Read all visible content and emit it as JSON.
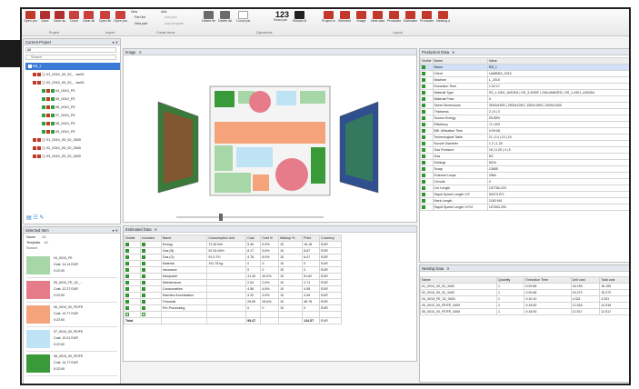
{
  "ribbon": {
    "buttons": [
      {
        "label": "Open project",
        "color": "#c0392b"
      },
      {
        "label": "Save",
        "color": "#b03030"
      },
      {
        "label": "Save as",
        "color": "#b03030"
      },
      {
        "label": "Close",
        "color": "#c94040"
      },
      {
        "label": "Clear all",
        "color": "#c94040"
      },
      {
        "label": "Open lib",
        "color": "#c94040"
      },
      {
        "label": "Open program",
        "color": "#c94040"
      }
    ],
    "new_header": "New",
    "new_items": [
      "Part list",
      "New part"
    ],
    "add_header": "Add",
    "add_items": [
      "Add part",
      "Add template"
    ],
    "ops_buttons": [
      {
        "label": "Delete item",
        "color": "#6b6b6b"
      },
      {
        "label": "Delete all items",
        "color": "#6b6b6b"
      },
      {
        "label": "Count parts",
        "color": "#9aa3ad"
      },
      {
        "label": "Read part values",
        "color": "#333333"
      },
      {
        "label": "Reload Materials",
        "color": "#222222"
      }
    ],
    "counter_glyph": "123",
    "layout_buttons": [
      {
        "label": "Project explorer",
        "color": "#c0392b"
      },
      {
        "label": "Selected parts",
        "color": "#c0392b"
      },
      {
        "label": "Image",
        "color": "#c0392b"
      },
      {
        "label": "Nest data",
        "color": "#c0392b"
      },
      {
        "label": "Production data",
        "color": "#c0392b"
      },
      {
        "label": "Estimated data",
        "color": "#c0392b"
      },
      {
        "label": "Production data",
        "color": "#c0392b"
      },
      {
        "label": "Nesting data",
        "color": "#c0392b"
      }
    ],
    "groups": [
      "Project",
      "Import",
      "Create items",
      "Operations",
      "Layout"
    ]
  },
  "project_panel": {
    "title": "Current Project",
    "filter": "All",
    "search_placeholder": "Search",
    "items": [
      {
        "label": "RB_1",
        "sel": true,
        "color": "#1f78c8"
      },
      {
        "label": "01_0010_00_02_...bw01",
        "color": "#c0392b"
      },
      {
        "label": "02_0010_00_02_...bw01",
        "color": "#c0392b"
      },
      {
        "label": "04_0010_FE",
        "color": "#3a9a3a"
      },
      {
        "label": "05_0010_FE",
        "color": "#3a9a3a"
      },
      {
        "label": "06_0010_FE",
        "color": "#3a9a3a"
      },
      {
        "label": "07_0010_FE",
        "color": "#3a9a3a"
      },
      {
        "label": "08_0010_FE",
        "color": "#3a9a3a"
      },
      {
        "label": "09_0010_FE",
        "color": "#3a9a3a"
      },
      {
        "label": "01_0010_00_02_3400",
        "color": "#c0392b"
      },
      {
        "label": "02_0010_00_02_3400",
        "color": "#c0392b"
      },
      {
        "label": "03_0010_00_02_3400",
        "color": "#c0392b"
      }
    ]
  },
  "image_panel": {
    "title": "Image"
  },
  "selected_panel": {
    "title": "Selected Item",
    "fields": [
      {
        "label": "Name",
        "value": "All"
      },
      {
        "label": "Template",
        "value": "All"
      }
    ],
    "search": "Search",
    "items": [
      {
        "name": "04_0010_FE",
        "value": "Cost: 14.14 EUR",
        "time": "0:22:00"
      },
      {
        "name": "05_0010_FE_02_...",
        "value": "Cost: 12.27 EUR",
        "time": "0:22:00"
      },
      {
        "name": "06_0010_00_FE/FE",
        "value": "Cost: 14.77 EUR",
        "time": "0:22:00"
      },
      {
        "name": "07_0010_00_FE/FE",
        "value": "Cost: 19.21 EUR",
        "time": "0:22:00"
      },
      {
        "name": "08_0010_00_FE/FE",
        "value": "Cost: 14.77 EUR",
        "time": "0:22:00"
      }
    ]
  },
  "estimated_panel": {
    "title": "Estimated Data",
    "columns": [
      "Visible",
      "Included",
      "Name",
      "Consumption Unit",
      "Cost",
      "Cost %",
      "Markup %",
      "Price",
      "Currency"
    ],
    "rows": [
      [
        "Energy",
        "72.45 Wh",
        "5.40",
        "6.9%",
        "10",
        "16.18",
        "EUR"
      ],
      [
        "Gas (N)",
        "92.34 kWh",
        "8.17",
        "5.6%",
        "10",
        "8.87",
        "EUR"
      ],
      [
        "Gas (O)",
        "91.0.79 l",
        "4.78",
        "8.0%",
        "10",
        "6.07",
        "EUR"
      ],
      [
        "Material",
        "191.78 kg",
        "0",
        "0",
        "10",
        "0",
        "EUR"
      ],
      [
        "Insurance",
        "",
        "0",
        "0",
        "10",
        "0",
        "EUR"
      ],
      [
        "Manpower",
        "",
        "41.40",
        "43.2%",
        "10",
        "51.62",
        "EUR"
      ],
      [
        "Maintenance",
        "",
        "2.54",
        "2.6%",
        "10",
        "2.71",
        "EUR"
      ],
      [
        "Consumables",
        "",
        "4.56",
        "4.8%",
        "10",
        "4.95",
        "EUR"
      ],
      [
        "Machine Amortization",
        "",
        "3.32",
        "3.5%",
        "10",
        "3.49",
        "EUR"
      ],
      [
        "Financial",
        "",
        "25.50",
        "26.6%",
        "10",
        "46.78",
        "EUR"
      ],
      [
        "Pre-Processing",
        "",
        "0",
        "0",
        "10",
        "0",
        "EUR"
      ]
    ],
    "total_label": "Total",
    "total_cost": "95.47",
    "total_price": "124.57",
    "total_currency": "EUR"
  },
  "production_panel": {
    "title": "Production Data",
    "columns": [
      "Visible",
      "Name",
      "Value"
    ],
    "rows": [
      [
        "Name",
        "RB_1"
      ],
      [
        "Client",
        "LAMBDA_2015"
      ],
      [
        "Machine",
        "L_2015"
      ],
      [
        "Execution Time",
        "1:22:17"
      ],
      [
        "Material Type",
        "SS_1.4301_AISI304 | SS_3.2030F | GALVANIZED | SS_1.4301_AISI304"
      ],
      [
        "Material Price",
        "0"
      ],
      [
        "Sheet Dimensions",
        "3000x1500 | 2500x1250 | 1500x1500 | 3000x1500"
      ],
      [
        "Thickness",
        "2 | 5 | 3"
      ],
      [
        "Source Energy",
        "25.55%"
      ],
      [
        "Efficiency",
        "71.15%"
      ],
      [
        "Biff. Utilisation Time",
        "0:09:08"
      ],
      [
        "Technological Table",
        "21 | 14 | 10 | 15"
      ],
      [
        "Nozzle Diameter",
        "1.2 | 1.25"
      ],
      [
        "Gas Pressure",
        "16 | 0.25 | 4 | 5"
      ],
      [
        "Gas",
        "N2"
      ],
      [
        "Drillings",
        "6024"
      ],
      [
        "Scrap",
        "13655"
      ],
      [
        "External Loops",
        "2564"
      ],
      [
        "Circuits",
        "0"
      ],
      [
        "Cut Length",
        "107760.223"
      ],
      [
        "Rapid Speed Length X/Y",
        "50073.971"
      ],
      [
        "Mark Length",
        "1180.941"
      ],
      [
        "Rapid Speed Length X/Y/Z",
        "107603.290"
      ]
    ]
  },
  "nesting_panel": {
    "title": "Nesting Data",
    "columns": [
      "Name",
      "Quantity",
      "Execution Time",
      "Unit cost",
      "Total cost"
    ],
    "rows": [
      [
        "01_0010_00_02_3400",
        "1",
        "0:29:58",
        "18.159",
        "18.159"
      ],
      [
        "02_0010_00_02_3400",
        "1",
        "0:29:48",
        "15.272",
        "15.272"
      ],
      [
        "04_0010_FE_02_3400",
        "1",
        "0:10:10",
        "4.331",
        "4.331"
      ],
      [
        "05_0010_00_FE/FE_3400",
        "1",
        "0:15:00",
        "12.516",
        "12.516"
      ],
      [
        "06_0010_00_FE/FE_3400",
        "1",
        "0:15:00",
        "12.517",
        "12.517"
      ]
    ]
  }
}
